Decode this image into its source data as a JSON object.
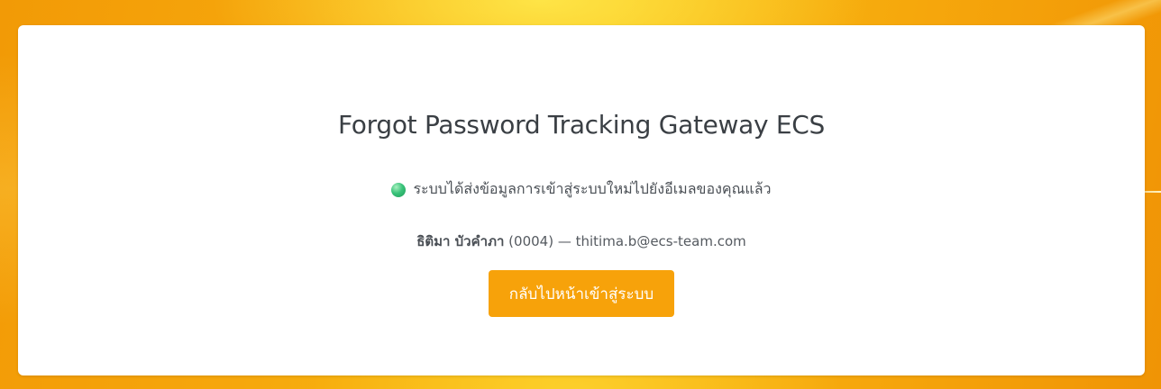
{
  "page": {
    "title": "Forgot Password Tracking Gateway ECS",
    "status_message": "ระบบได้ส่งข้อมูลการเข้าสู่ระบบใหม่ไปยังอีเมลของคุณแล้ว",
    "status_color": "#3ac37a",
    "user": {
      "name": "ธิติมา บัวคำภา",
      "code": "(0004)",
      "separator": "—",
      "email": "thitima.b@ecs-team.com"
    },
    "back_button_label": "กลับไปหน้าเข้าสู่ระบบ",
    "accent_color": "#f7a20a"
  }
}
